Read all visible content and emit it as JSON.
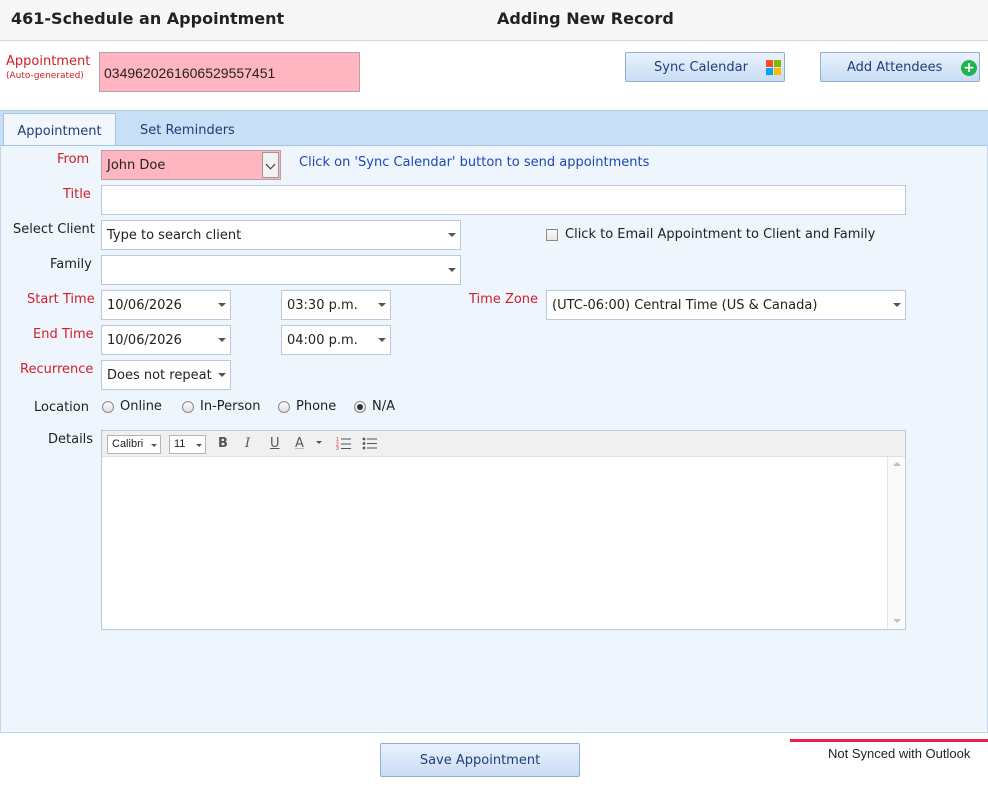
{
  "header": {
    "screen_title": "461-Schedule an Appointment",
    "record_status": "Adding New Record"
  },
  "appointment_id": {
    "label": "Appointment",
    "sublabel": "(Auto-generated)",
    "value": "0349620261606529557451"
  },
  "toolbar": {
    "sync_calendar_label": "Sync Calendar",
    "add_attendees_label": "Add Attendees"
  },
  "tabs": [
    {
      "label": "Appointment",
      "active": true
    },
    {
      "label": "Set Reminders",
      "active": false
    }
  ],
  "form": {
    "from": {
      "label": "From",
      "value": "John Doe"
    },
    "hint": "Click on 'Sync Calendar' button to send appointments",
    "title": {
      "label": "Title",
      "value": ""
    },
    "client": {
      "label": "Select Client",
      "placeholder": "Type to search client"
    },
    "email_option": {
      "label": "Click to Email Appointment to Client and Family",
      "checked": false
    },
    "family": {
      "label": "Family",
      "value": ""
    },
    "start_time": {
      "label": "Start Time",
      "date": "10/06/2026",
      "time": "03:30 p.m."
    },
    "end_time": {
      "label": "End Time",
      "date": "10/06/2026",
      "time": "04:00 p.m."
    },
    "time_zone": {
      "label": "Time Zone",
      "value": "(UTC-06:00) Central Time (US & Canada)"
    },
    "recurrence": {
      "label": "Recurrence",
      "value": "Does not repeat"
    },
    "location": {
      "label": "Location",
      "options": [
        "Online",
        "In-Person",
        "Phone",
        "N/A"
      ],
      "selected": "N/A"
    },
    "details": {
      "label": "Details",
      "font": "Calibri",
      "font_size": "11",
      "bold": "B",
      "italic": "I",
      "underline": "U",
      "font_color": "A"
    }
  },
  "footer": {
    "save_label": "Save Appointment",
    "sync_status": "Not Synced with Outlook",
    "sync_status_color": "#e8204a"
  },
  "colors": {
    "required_label": "#d0202a",
    "highlight_field": "#ffb6c1",
    "panel_background": "#eef5fd",
    "tabstrip": "#c9dff6",
    "hint_text": "#1e47b3",
    "add_icon": "#1db64a"
  }
}
